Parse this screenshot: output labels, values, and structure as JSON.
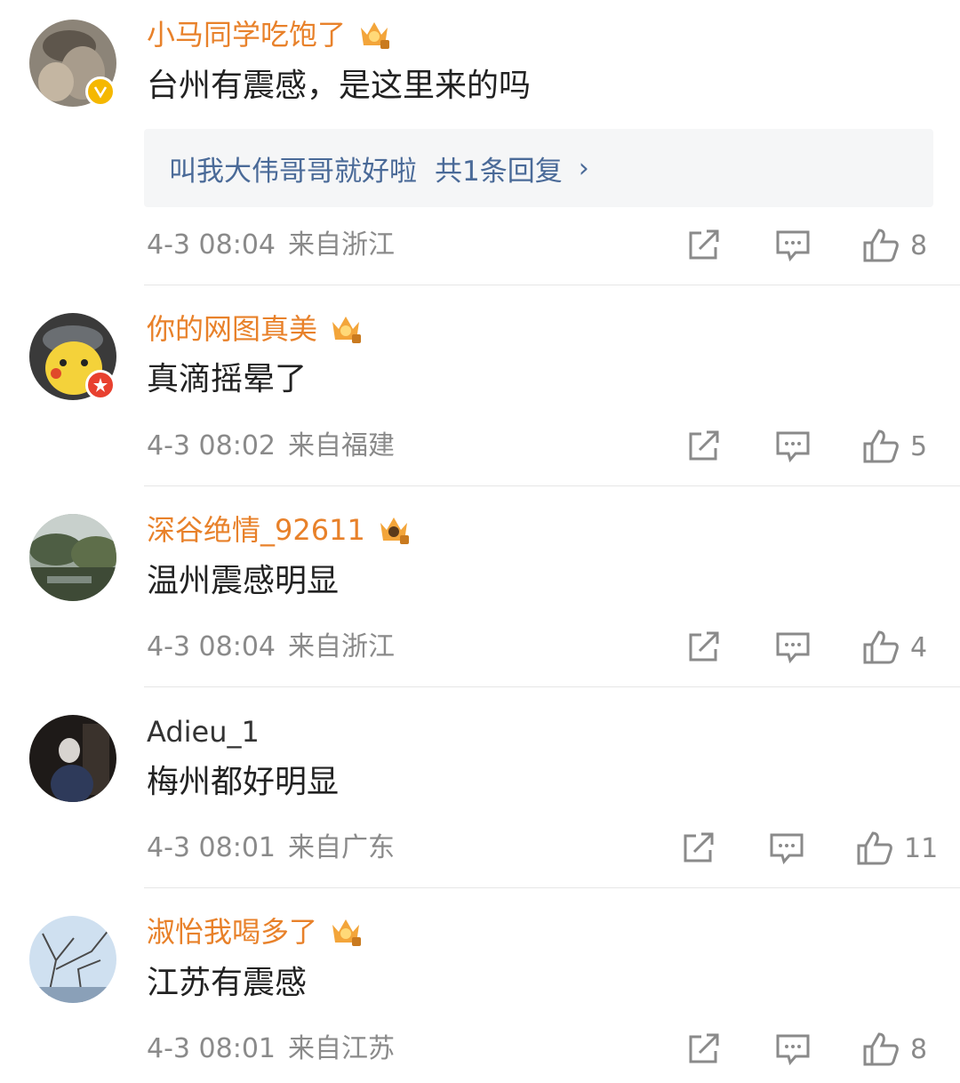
{
  "comments": [
    {
      "username": "小马同学吃饱了",
      "text": "台州有震感，是这里来的吗",
      "time": "4-3 08:04",
      "location": "来自浙江",
      "likes": "8",
      "reply": {
        "name": "叫我大伟哥哥就好啦",
        "count_text": "共1条回复"
      }
    },
    {
      "username": "你的网图真美",
      "text": "真滴摇晕了",
      "time": "4-3 08:02",
      "location": "来自福建",
      "likes": "5"
    },
    {
      "username": "深谷绝情_92611",
      "text": "温州震感明显",
      "time": "4-3 08:04",
      "location": "来自浙江",
      "likes": "4"
    },
    {
      "username": "Adieu_1",
      "text": "梅州都好明显",
      "time": "4-3 08:01",
      "location": "来自广东",
      "likes": "11"
    },
    {
      "username": "淑怡我喝多了",
      "text": "江苏有震感",
      "time": "4-3 08:01",
      "location": "来自江苏",
      "likes": "8"
    }
  ],
  "icons": {
    "repost": "share-icon",
    "comment": "comment-icon",
    "like": "thumbs-up-icon",
    "vip": "crown-icon",
    "verified": "verified-v-icon"
  },
  "colors": {
    "username_vip": "#e8812a",
    "reply_link": "#4a6a98",
    "meta_gray": "#8a8a8a",
    "verified_yellow": "#f5b800",
    "badge_red": "#e8402f"
  }
}
